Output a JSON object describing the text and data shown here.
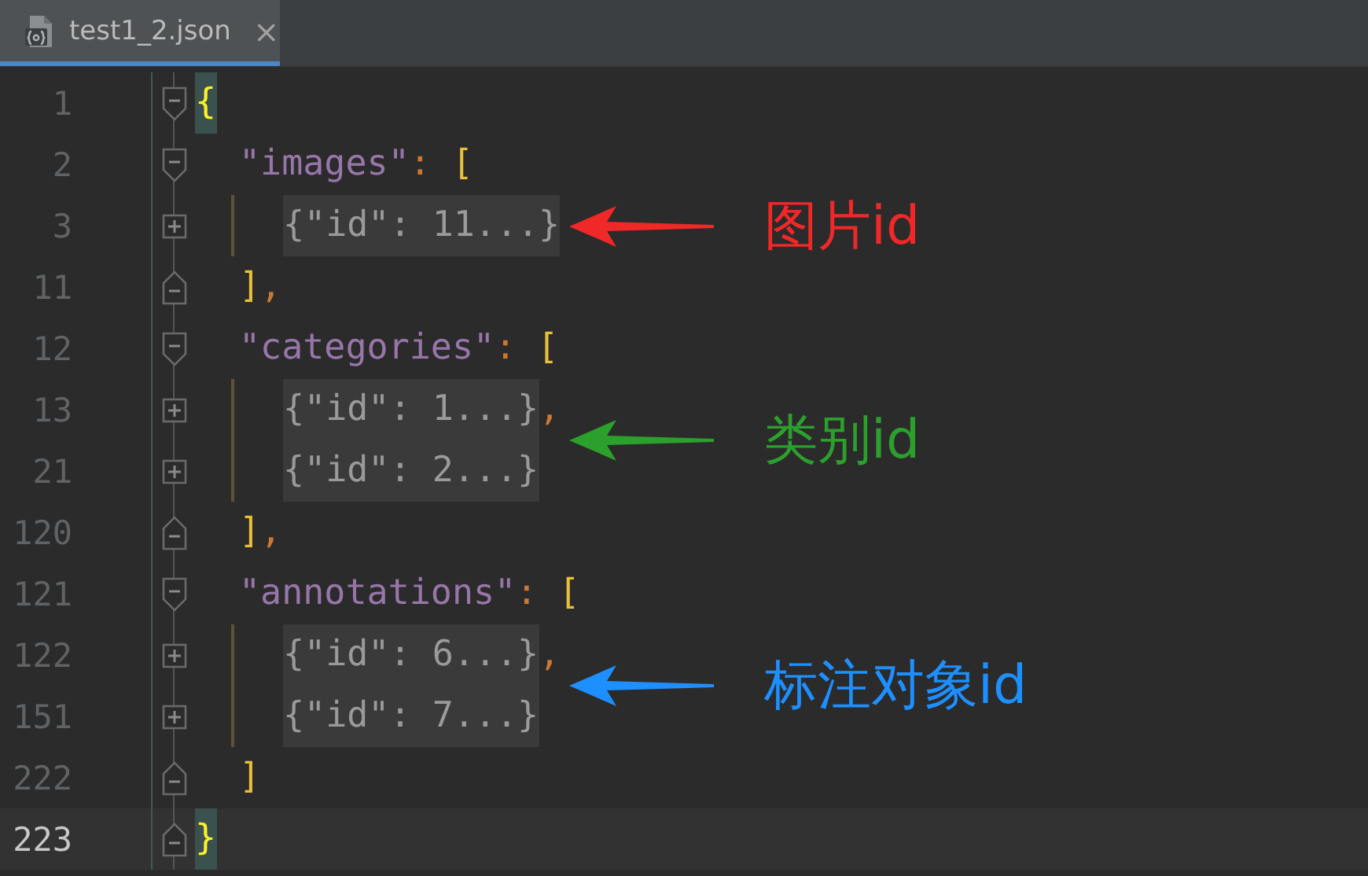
{
  "tabs": [
    {
      "label": "test1_2.json",
      "close": "×",
      "selected": true
    }
  ],
  "lines": [
    {
      "number": "1",
      "kind": "open",
      "current": false,
      "tokens": [
        {
          "kind": "brace",
          "text": "{",
          "highlighted": true
        }
      ],
      "children": [
        {
          "number": "2",
          "kind": "open",
          "current": false,
          "tokens": [
            {
              "kind": "key",
              "text": "\"images\""
            },
            {
              "kind": "colon",
              "text": ":"
            },
            {
              "kind": "bracket",
              "text": "["
            }
          ],
          "children": [
            {
              "number": "3",
              "kind": "expand",
              "current": false,
              "tokens": [
                {
                  "kind": "folded",
                  "text": "{\"id\": 11...}"
                }
              ],
              "note": {
                "text": "图片id",
                "color": "#f02828"
              }
            }
          ]
        },
        {
          "number": "11",
          "kind": "close",
          "current": false,
          "tokens": [
            {
              "kind": "bracket",
              "text": "]"
            },
            {
              "kind": "comma",
              "text": ","
            }
          ]
        },
        {
          "number": "12",
          "kind": "open",
          "current": false,
          "tokens": [
            {
              "kind": "key",
              "text": "\"categories\""
            },
            {
              "kind": "colon",
              "text": ":"
            },
            {
              "kind": "bracket",
              "text": "["
            }
          ],
          "children": [
            {
              "number": "13",
              "kind": "expand",
              "current": false,
              "tokens": [
                {
                  "kind": "folded",
                  "text": "{\"id\": 1...}"
                },
                {
                  "kind": "comma",
                  "text": ","
                }
              ],
              "note": {
                "text": "类别id",
                "color": "#2ca02c"
              }
            },
            {
              "number": "21",
              "kind": "expand",
              "current": false,
              "tokens": [
                {
                  "kind": "folded",
                  "text": "{\"id\": 2...}"
                }
              ]
            }
          ]
        },
        {
          "number": "120",
          "kind": "close",
          "current": false,
          "tokens": [
            {
              "kind": "bracket",
              "text": "]"
            },
            {
              "kind": "comma",
              "text": ","
            }
          ]
        },
        {
          "number": "121",
          "kind": "open",
          "current": false,
          "tokens": [
            {
              "kind": "key",
              "text": "\"annotations\""
            },
            {
              "kind": "colon",
              "text": ":"
            },
            {
              "kind": "bracket",
              "text": "["
            }
          ],
          "children": [
            {
              "number": "122",
              "kind": "expand",
              "current": false,
              "tokens": [
                {
                  "kind": "folded",
                  "text": "{\"id\": 6...}"
                },
                {
                  "kind": "comma",
                  "text": ","
                }
              ],
              "note": {
                "text": "标注对象id",
                "color": "#1e8fff"
              }
            },
            {
              "number": "151",
              "kind": "expand",
              "current": false,
              "tokens": [
                {
                  "kind": "folded",
                  "text": "{\"id\": 7...}"
                }
              ]
            }
          ]
        },
        {
          "number": "222",
          "kind": "close",
          "current": false,
          "tokens": [
            {
              "kind": "bracket",
              "text": "]"
            }
          ]
        }
      ]
    },
    {
      "number": "223",
      "kind": "close",
      "current": true,
      "tokens": [
        {
          "kind": "brace",
          "text": "}",
          "highlighted": true
        }
      ]
    }
  ]
}
